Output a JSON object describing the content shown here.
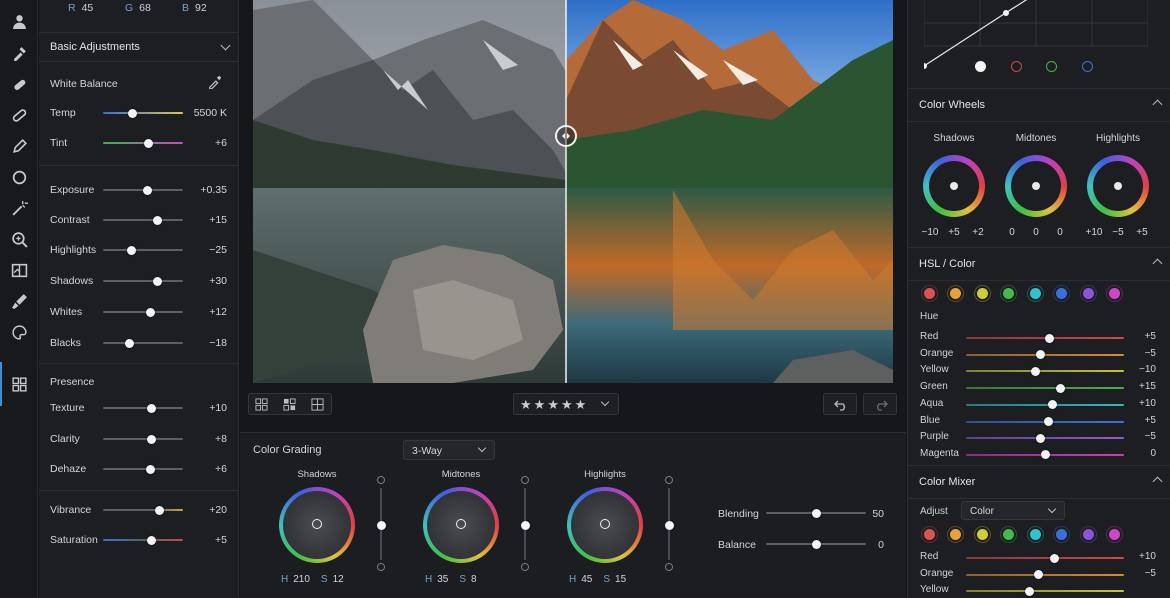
{
  "rgb": {
    "r_label": "R",
    "r": "45",
    "g_label": "G",
    "g": "68",
    "b_label": "B",
    "b": "92"
  },
  "basic": {
    "title": "Basic Adjustments",
    "white_balance": "White Balance",
    "wb": [
      {
        "label": "Temp",
        "value": "5500 K",
        "pos": 0.37
      },
      {
        "label": "Tint",
        "value": "+6",
        "pos": 0.57
      }
    ],
    "tone": [
      {
        "label": "Exposure",
        "value": "+0.35",
        "pos": 0.56
      },
      {
        "label": "Contrast",
        "value": "+15",
        "pos": 0.68
      },
      {
        "label": "Highlights",
        "value": "−25",
        "pos": 0.35
      },
      {
        "label": "Shadows",
        "value": "+30",
        "pos": 0.68
      },
      {
        "label": "Whites",
        "value": "+12",
        "pos": 0.59
      },
      {
        "label": "Blacks",
        "value": "−18",
        "pos": 0.33
      }
    ],
    "presence_title": "Presence",
    "presence": [
      {
        "label": "Texture",
        "value": "+10",
        "pos": 0.61
      },
      {
        "label": "Clarity",
        "value": "+8",
        "pos": 0.6
      },
      {
        "label": "Dehaze",
        "value": "+6",
        "pos": 0.59
      }
    ],
    "color": [
      {
        "label": "Vibrance",
        "value": "+20",
        "pos": 0.7
      },
      {
        "label": "Saturation",
        "value": "+5",
        "pos": 0.6
      }
    ]
  },
  "rating": {
    "stars": 5
  },
  "color_grading": {
    "title": "Color Grading",
    "mode": "3-Way",
    "wheels": [
      {
        "label": "Shadows",
        "h": "210",
        "s": "12",
        "lum": 0.5
      },
      {
        "label": "Midtones",
        "h": "35",
        "s": "8",
        "lum": 0.5
      },
      {
        "label": "Highlights",
        "h": "45",
        "s": "15",
        "lum": 0.5
      }
    ],
    "h_label": "H",
    "s_label": "S",
    "blending_label": "Blending",
    "blending": "50",
    "blending_pos": 0.5,
    "balance_label": "Balance",
    "balance": "0",
    "balance_pos": 0.5
  },
  "color_wheels": {
    "title": "Color Wheels",
    "wheels": [
      {
        "label": "Shadows",
        "vals": [
          "−10",
          "+5",
          "+2"
        ]
      },
      {
        "label": "Midtones",
        "vals": [
          "0",
          "0",
          "0"
        ]
      },
      {
        "label": "Highlights",
        "vals": [
          "+10",
          "−5",
          "+5"
        ]
      }
    ]
  },
  "hsl": {
    "title": "HSL / Color",
    "sub": "Hue",
    "rows": [
      {
        "label": "Red",
        "value": "+5",
        "pos": 0.53,
        "color": "#d04848"
      },
      {
        "label": "Orange",
        "value": "−5",
        "pos": 0.47,
        "color": "#d88a3a"
      },
      {
        "label": "Yellow",
        "value": "−10",
        "pos": 0.44,
        "color": "#c8c23a"
      },
      {
        "label": "Green",
        "value": "+15",
        "pos": 0.6,
        "color": "#4caf50"
      },
      {
        "label": "Aqua",
        "value": "+10",
        "pos": 0.55,
        "color": "#33b8c0"
      },
      {
        "label": "Blue",
        "value": "+5",
        "pos": 0.52,
        "color": "#3f72d6"
      },
      {
        "label": "Purple",
        "value": "−5",
        "pos": 0.47,
        "color": "#8e5ad0"
      },
      {
        "label": "Magenta",
        "value": "0",
        "pos": 0.5,
        "color": "#c83fb8"
      }
    ]
  },
  "mixer": {
    "title": "Color Mixer",
    "adjust_label": "Adjust",
    "adjust_value": "Color",
    "rows": [
      {
        "label": "Red",
        "value": "+10",
        "pos": 0.56,
        "color": "#d04848"
      },
      {
        "label": "Orange",
        "value": "−5",
        "pos": 0.46,
        "color": "#d88a3a"
      },
      {
        "label": "Yellow",
        "value": "",
        "pos": 0.4,
        "color": "#c8c23a"
      }
    ]
  },
  "swatches": [
    "#d9534f",
    "#e8a23a",
    "#cfcf35",
    "#46b94c",
    "#31c3c9",
    "#3a6fe0",
    "#8a55d6",
    "#cf45c8"
  ]
}
